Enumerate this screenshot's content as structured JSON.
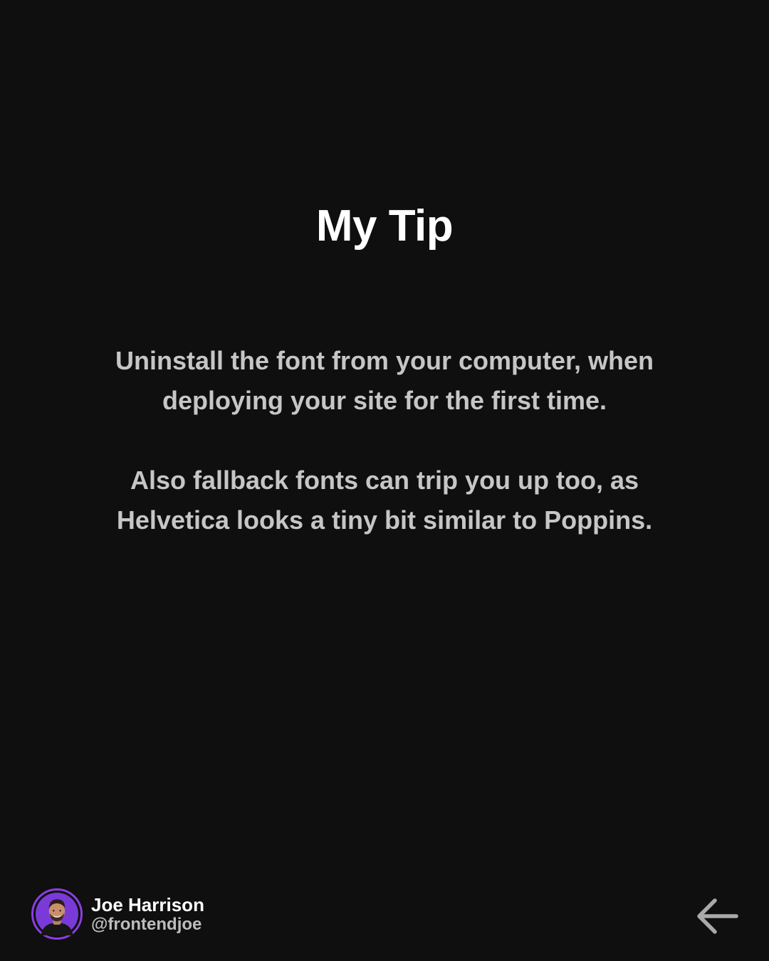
{
  "slide": {
    "title": "My Tip",
    "paragraphs": [
      "Uninstall the font from your computer, when deploying your site for the first time.",
      "Also fallback fonts can trip you up too, as Helvetica looks a tiny bit similar to Poppins."
    ]
  },
  "author": {
    "name": "Joe Harrison",
    "handle": "@frontendjoe",
    "avatar_icon": "profile-photo-avatar"
  },
  "navigation": {
    "back_icon": "arrow-left-icon"
  },
  "colors": {
    "background": "#0f0f0f",
    "title": "#ffffff",
    "body_text": "#c6c6c6",
    "accent": "#8a3fe0",
    "arrow": "#a9a9a9"
  }
}
